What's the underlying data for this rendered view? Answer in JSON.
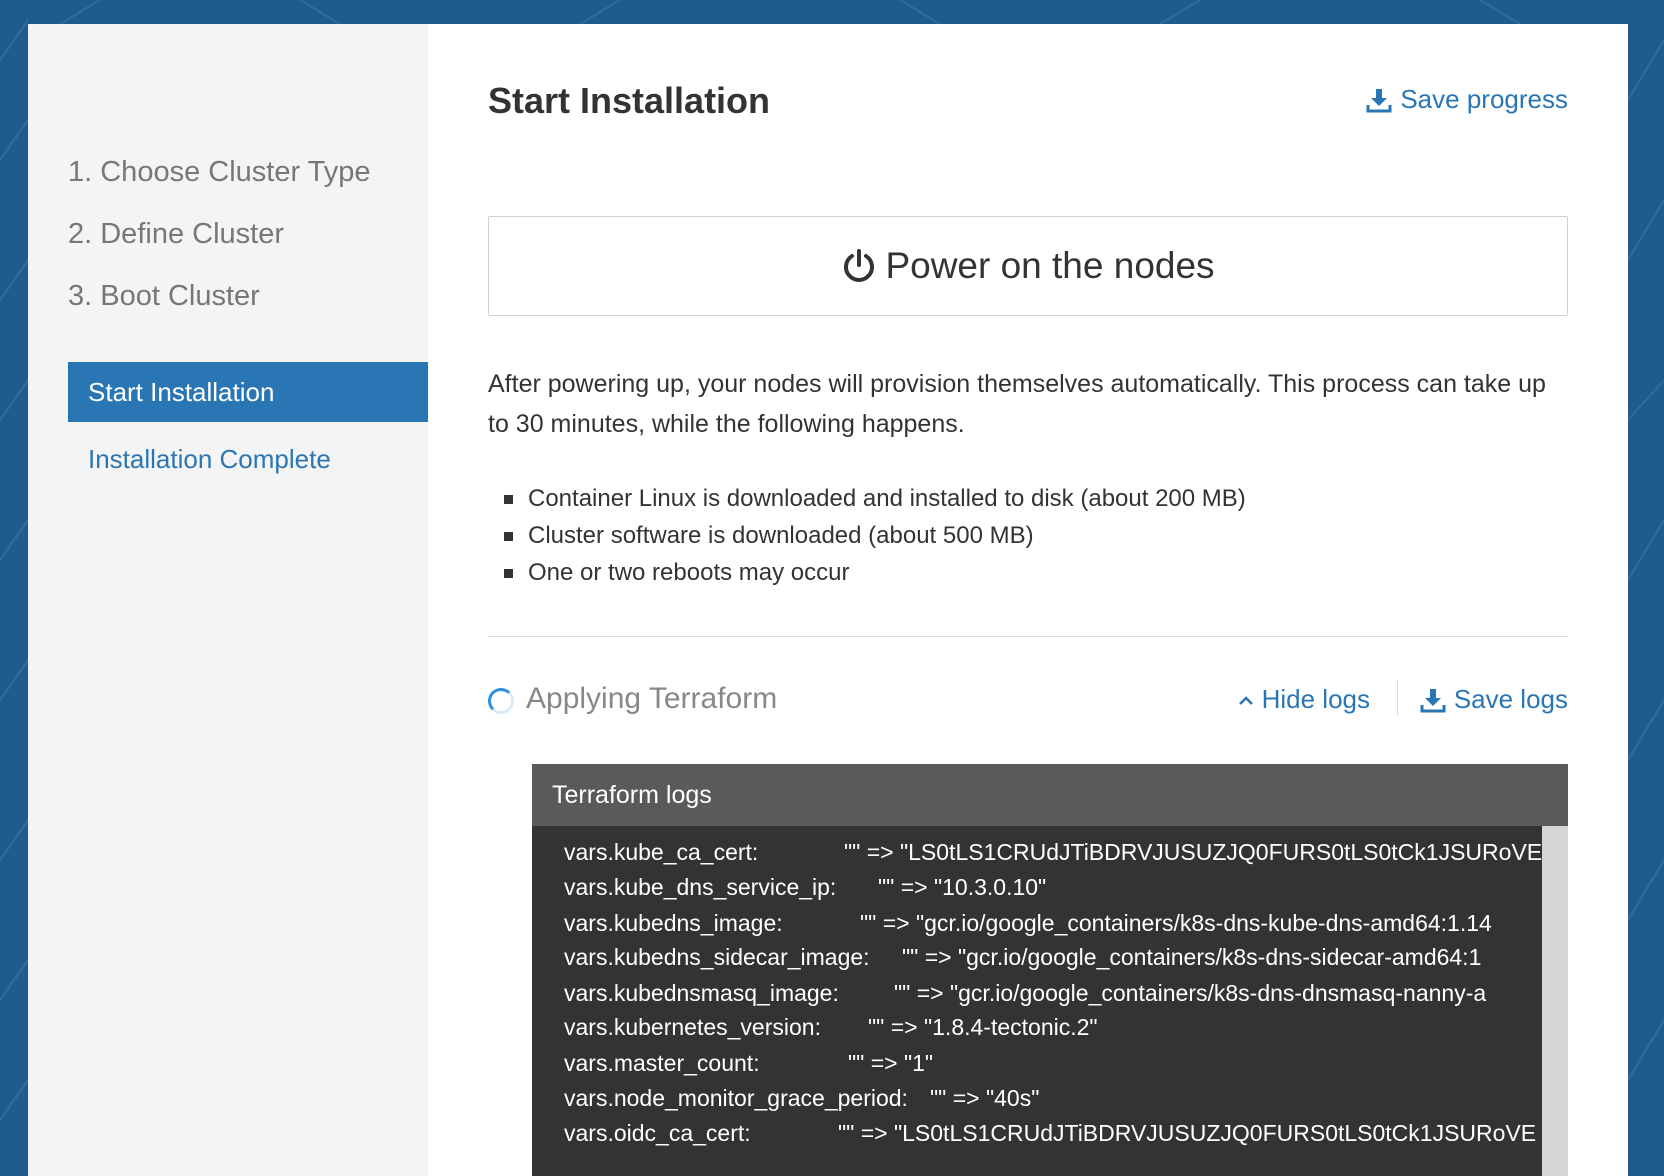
{
  "sidebar": {
    "steps": [
      {
        "label": "1. Choose Cluster Type"
      },
      {
        "label": "2. Define Cluster"
      },
      {
        "label": "3. Boot Cluster"
      }
    ],
    "active_step": "Start Installation",
    "next_step": "Installation Complete"
  },
  "header": {
    "title": "Start Installation",
    "save_progress": "Save progress"
  },
  "power_button": {
    "label": "Power on the nodes",
    "icon": "power-icon"
  },
  "description": "After powering up, your nodes will provision themselves automatically. This process can take up to 30 minutes, while the following happens.",
  "bullets": [
    "Container Linux is downloaded and installed to disk (about 200 MB)",
    "Cluster software is downloaded (about 500 MB)",
    "One or two reboots may occur"
  ],
  "status": {
    "text": "Applying Terraform",
    "hide_logs": "Hide logs",
    "save_logs": "Save logs"
  },
  "logs": {
    "title": "Terraform logs",
    "lines": [
      {
        "key": "vars.kube_ca_cert:",
        "value": "\"\" => \"LS0tLS1CRUdJTiBDRVJUSUZJQ0FURS0tLS0tCk1JSURoVE"
      },
      {
        "key": "vars.kube_dns_service_ip:",
        "value": "\"\" => \"10.3.0.10\""
      },
      {
        "key": "vars.kubedns_image:",
        "value": "\"\" => \"gcr.io/google_containers/k8s-dns-kube-dns-amd64:1.14"
      },
      {
        "key": "vars.kubedns_sidecar_image:",
        "value": "\"\" => \"gcr.io/google_containers/k8s-dns-sidecar-amd64:1"
      },
      {
        "key": "vars.kubednsmasq_image:",
        "value": "\"\" => \"gcr.io/google_containers/k8s-dns-dnsmasq-nanny-a"
      },
      {
        "key": "vars.kubernetes_version:",
        "value": "\"\" => \"1.8.4-tectonic.2\""
      },
      {
        "key": "vars.master_count:",
        "value": "\"\" => \"1\""
      },
      {
        "key": "vars.node_monitor_grace_period:",
        "value": "\"\" => \"40s\""
      },
      {
        "key": "vars.oidc_ca_cert:",
        "value": "\"\" => \"LS0tLS1CRUdJTiBDRVJUSUZJQ0FURS0tLS0tCk1JSURoVE"
      }
    ]
  },
  "colors": {
    "accent": "#2a76b4",
    "background": "#1f5b8e",
    "logs_bg": "#333333",
    "logs_header": "#5a5a5a"
  }
}
